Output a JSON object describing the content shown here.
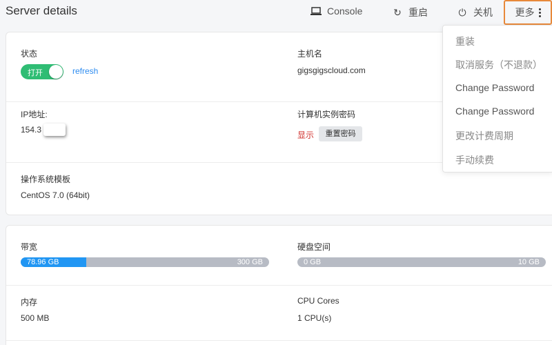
{
  "header": {
    "title": "Server details",
    "actions": {
      "console": "Console",
      "restart": "重启",
      "shutdown": "关机",
      "more": "更多"
    }
  },
  "status": {
    "label": "状态",
    "toggle_text": "打开",
    "toggle_on": true,
    "refresh": "refresh"
  },
  "hostname": {
    "label": "主机名",
    "value": "gigsgigscloud.com"
  },
  "ip": {
    "label": "IP地址:",
    "value": "154.3"
  },
  "password": {
    "label": "计算机实例密码",
    "show": "显示",
    "reset": "重置密码"
  },
  "os": {
    "label": "操作系统模板",
    "value": "CentOS 7.0 (64bit)"
  },
  "bandwidth": {
    "label": "带宽",
    "used": "78.96 GB",
    "total": "300 GB",
    "fraction": 0.263
  },
  "disk": {
    "label": "硬盘空间",
    "used": "0 GB",
    "total": "10 GB",
    "fraction": 0.0
  },
  "memory": {
    "label": "内存",
    "value": "500 MB"
  },
  "cpu": {
    "label": "CPU Cores",
    "value": "1 CPU(s)"
  },
  "more_menu": {
    "items": [
      "重装",
      "取消服务（不退款）",
      "Change Password",
      "Change Password",
      "更改计费周期",
      "手动续费"
    ]
  },
  "colors": {
    "toggle": "#2fbd74",
    "link": "#2d8cf0",
    "danger": "#d0312d",
    "progress": "#2196f3",
    "highlight_border": "#e8893a"
  }
}
